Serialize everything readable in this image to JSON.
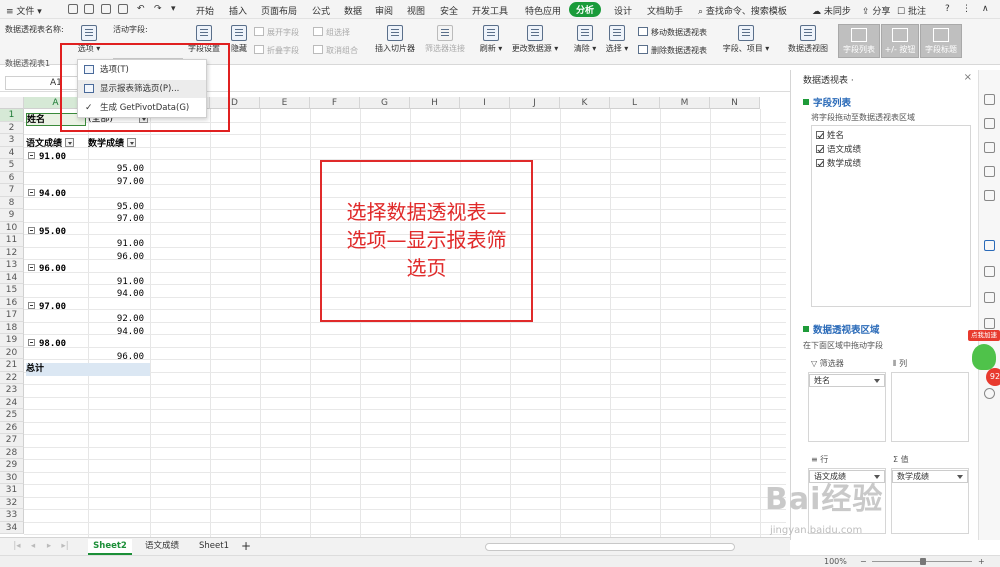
{
  "menubar": {
    "file": "文件",
    "tabs": [
      "开始",
      "插入",
      "页面布局",
      "公式",
      "数据",
      "审阅",
      "视图",
      "安全",
      "开发工具",
      "特色应用",
      "分析",
      "设计",
      "文档助手"
    ],
    "active_tab": "分析",
    "search": "查找命令、搜索模板",
    "sync": "未同步",
    "share": "分享",
    "comment": "批注",
    "help": "?"
  },
  "ribbon": {
    "ptname_label": "数据透视表名称:",
    "ptname_value": "数据透视表1",
    "options_label": "选项",
    "active_field_label": "活动字段:",
    "active_field_value": "姓名",
    "field_settings": "字段设置",
    "hide": "隐藏",
    "expand_field": "展开字段",
    "collapse_field": "折叠字段",
    "group_selection": "组选择",
    "ungroup": "取消组合",
    "insert_slicer": "插入切片器",
    "filter_connection": "筛选器连接",
    "refresh": "刷新",
    "change_source": "更改数据源",
    "clear": "清除",
    "select": "选择",
    "move_pivot": "移动数据透视表",
    "delete_pivot": "删除数据透视表",
    "fields_items": "字段、项目",
    "pivot_chart": "数据透视图",
    "field_list": "字段列表",
    "plus_minus": "+/- 按钮",
    "field_headers": "字段标题"
  },
  "formula": {
    "cell_ref": "A1"
  },
  "dropdown": {
    "items": [
      "选项(T)",
      "显示报表筛选页(P)...",
      "生成 GetPivotData(G)"
    ]
  },
  "sheet": {
    "columns": [
      "A",
      "B",
      "C",
      "D",
      "E",
      "F",
      "G",
      "H",
      "I",
      "J",
      "K",
      "L",
      "M",
      "N"
    ],
    "rows": [
      "1",
      "2",
      "3",
      "4",
      "5",
      "6",
      "7",
      "8",
      "9",
      "10",
      "11",
      "12",
      "13",
      "14",
      "15",
      "16",
      "17",
      "18",
      "19",
      "20",
      "21",
      "22",
      "23",
      "24",
      "25",
      "26",
      "27",
      "28",
      "29",
      "30",
      "31",
      "32",
      "33",
      "34"
    ],
    "filter_name": "姓名",
    "filter_value": "(全部)",
    "header_a": "语文成绩",
    "header_b": "数学成绩",
    "groups": [
      {
        "score": "91.00",
        "values": [
          "95.00",
          "97.00"
        ]
      },
      {
        "score": "94.00",
        "values": [
          "95.00",
          "97.00"
        ]
      },
      {
        "score": "95.00",
        "values": [
          "91.00",
          "96.00"
        ]
      },
      {
        "score": "96.00",
        "values": [
          "91.00",
          "94.00"
        ]
      },
      {
        "score": "97.00",
        "values": [
          "92.00",
          "94.00"
        ]
      },
      {
        "score": "98.00",
        "values": [
          "96.00"
        ]
      }
    ],
    "total": "总计"
  },
  "annotation": {
    "line1": "选择数据透视表—",
    "line2": "选项—显示报表筛",
    "line3": "选页"
  },
  "panel": {
    "title": "数据透视表 ·",
    "close": "×",
    "field_list_title": "字段列表",
    "drag_hint": "将字段拖动至数据透视表区域",
    "fields": [
      "姓名",
      "语文成绩",
      "数学成绩"
    ],
    "area_title": "数据透视表区域",
    "area_hint": "在下面区域中拖动字段",
    "filter_label": "筛选器",
    "column_label": "列",
    "row_label": "行",
    "value_label": "值",
    "filter_item": "姓名",
    "row_item": "语文成绩",
    "value_item": "数学成绩"
  },
  "tabs": [
    "Sheet2",
    "语文成绩",
    "Sheet1"
  ],
  "active_sheet": "Sheet2",
  "status": {
    "zoom": "100%"
  },
  "watermark": {
    "brand": "Bai经验",
    "url": "jingyan.baidu.com"
  },
  "badge": {
    "text": "点我加速",
    "num": "92"
  }
}
